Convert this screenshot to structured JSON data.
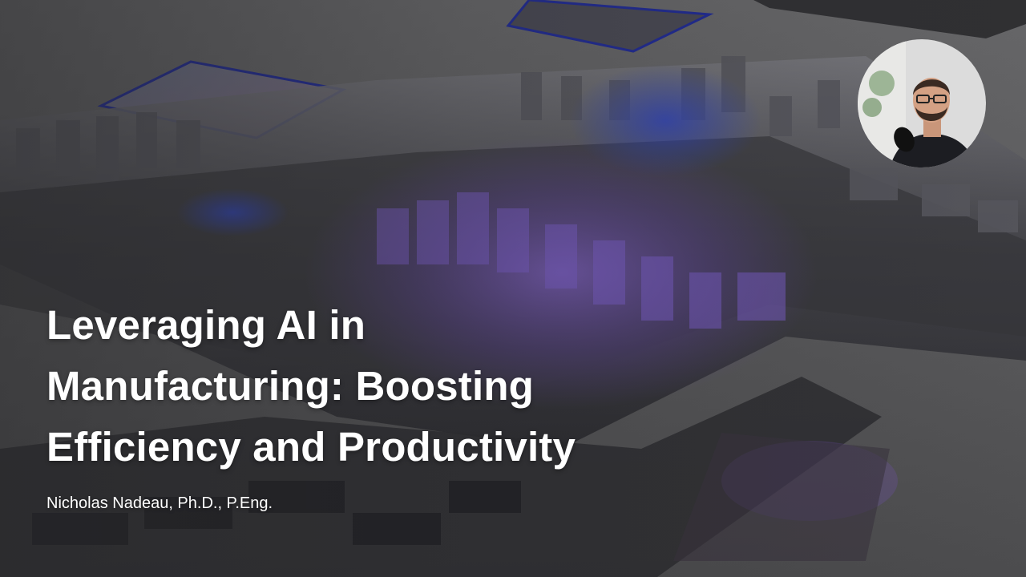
{
  "slide": {
    "title_lines": [
      "Leveraging AI in",
      "Manufacturing: Boosting",
      "Efficiency and Productivity"
    ],
    "author": "Nicholas Nadeau, Ph.D., P.Eng."
  },
  "visual": {
    "background_image": "3d-render-manufacturing-mold-parts",
    "presenter_webcam": "circular-presenter-camera-feed",
    "colors": {
      "background": "#5f5f61",
      "metal_dark": "#2b2b2f",
      "metal_mid": "#55555a",
      "glow_purple": "#7a55c8",
      "glow_blue": "#2a3fb0",
      "panel_edge": "#1f2a9a",
      "text": "#ffffff"
    }
  }
}
